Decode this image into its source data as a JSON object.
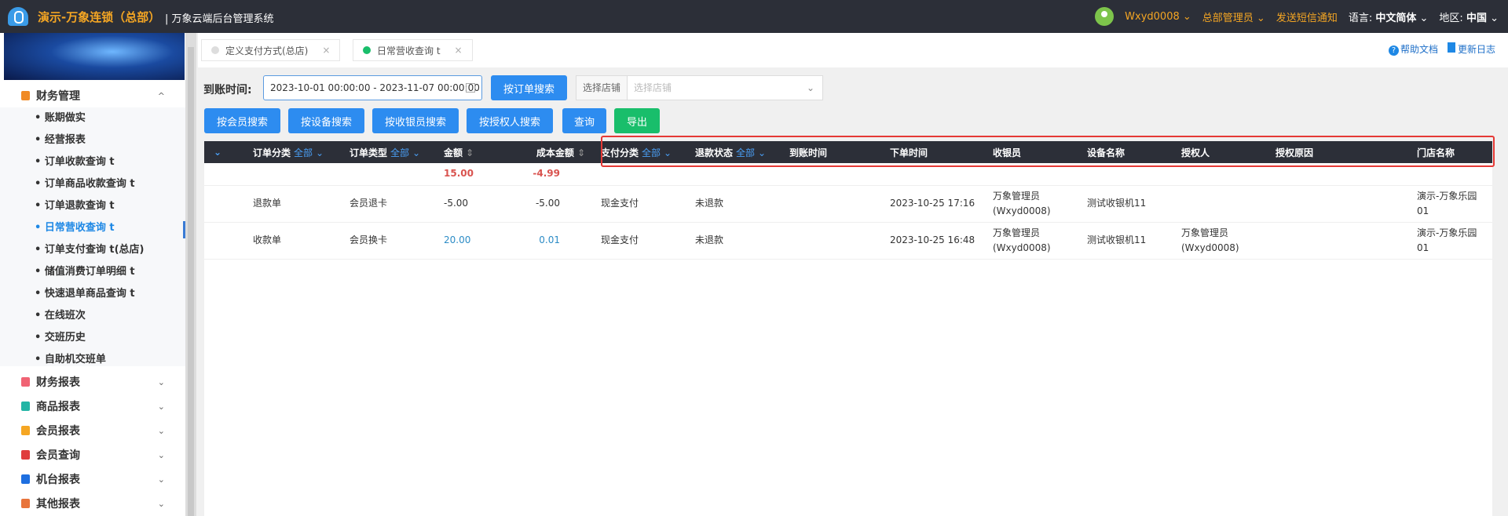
{
  "header": {
    "brand": "演示-万象连锁（总部）",
    "system": "| 万象云端后台管理系统",
    "user": "Wxyd0008",
    "role": "总部管理员",
    "sms": "发送短信通知",
    "lang_label": "语言:",
    "lang": "中文简体",
    "region_label": "地区:",
    "region": "中国"
  },
  "sidebar": {
    "group_open": "财务管理",
    "items": [
      "账期做实",
      "经营报表",
      "订单收款查询 t",
      "订单商品收款查询 t",
      "订单退款查询 t",
      "日常营收查询 t",
      "订单支付查询 t(总店)",
      "储值消费订单明细 t",
      "快速退单商品查询 t",
      "在线班次",
      "交班历史",
      "自助机交班单"
    ],
    "active_index": 5,
    "groups": [
      {
        "label": "财务报表",
        "color": "#f06374"
      },
      {
        "label": "商品报表",
        "color": "#22b5a5"
      },
      {
        "label": "会员报表",
        "color": "#f5a623"
      },
      {
        "label": "会员查询",
        "color": "#e03c3c"
      },
      {
        "label": "机台报表",
        "color": "#1e6fe0"
      },
      {
        "label": "其他报表",
        "color": "#e8743b"
      }
    ]
  },
  "tabs": [
    {
      "label": "定义支付方式(总店)",
      "active": false
    },
    {
      "label": "日常营收查询 t",
      "active": true
    }
  ],
  "help": {
    "doc": "帮助文档",
    "log": "更新日志"
  },
  "filters": {
    "date_label": "到账时间:",
    "date_value": "2023-10-01 00:00:00 - 2023-11-07 00:00:00",
    "order_search": "按订单搜索",
    "store_label": "选择店铺",
    "store_placeholder": "选择店铺"
  },
  "buttons": [
    "按会员搜索",
    "按设备搜索",
    "按收银员搜索",
    "按授权人搜索",
    "查询",
    "导出"
  ],
  "table": {
    "filter_all": "全部",
    "columns": [
      "订单分类",
      "订单类型",
      "金额",
      "成本金额",
      "支付分类",
      "退款状态",
      "到账时间",
      "下单时间",
      "收银员",
      "设备名称",
      "授权人",
      "授权原因",
      "门店名称"
    ],
    "summary": {
      "amount": "15.00",
      "cost": "-4.99"
    },
    "rows": [
      {
        "category": "退款单",
        "type": "会员退卡",
        "amount": "-5.00",
        "cost": "-5.00",
        "pay": "现金支付",
        "refund": "未退款",
        "arrive": "",
        "order_time": "2023-10-25 17:16",
        "cashier": "万象管理员",
        "cashier_id": "(Wxyd0008)",
        "device": "测试收银机11",
        "auth": "",
        "auth_id": "",
        "reason": "",
        "store": "演示-万象乐园",
        "store2": "01"
      },
      {
        "category": "收款单",
        "type": "会员换卡",
        "amount": "20.00",
        "cost": "0.01",
        "pay": "现金支付",
        "refund": "未退款",
        "arrive": "",
        "order_time": "2023-10-25 16:48",
        "cashier": "万象管理员",
        "cashier_id": "(Wxyd0008)",
        "device": "测试收银机11",
        "auth": "万象管理员",
        "auth_id": "(Wxyd0008)",
        "reason": "",
        "store": "演示-万象乐园",
        "store2": "01"
      }
    ]
  }
}
